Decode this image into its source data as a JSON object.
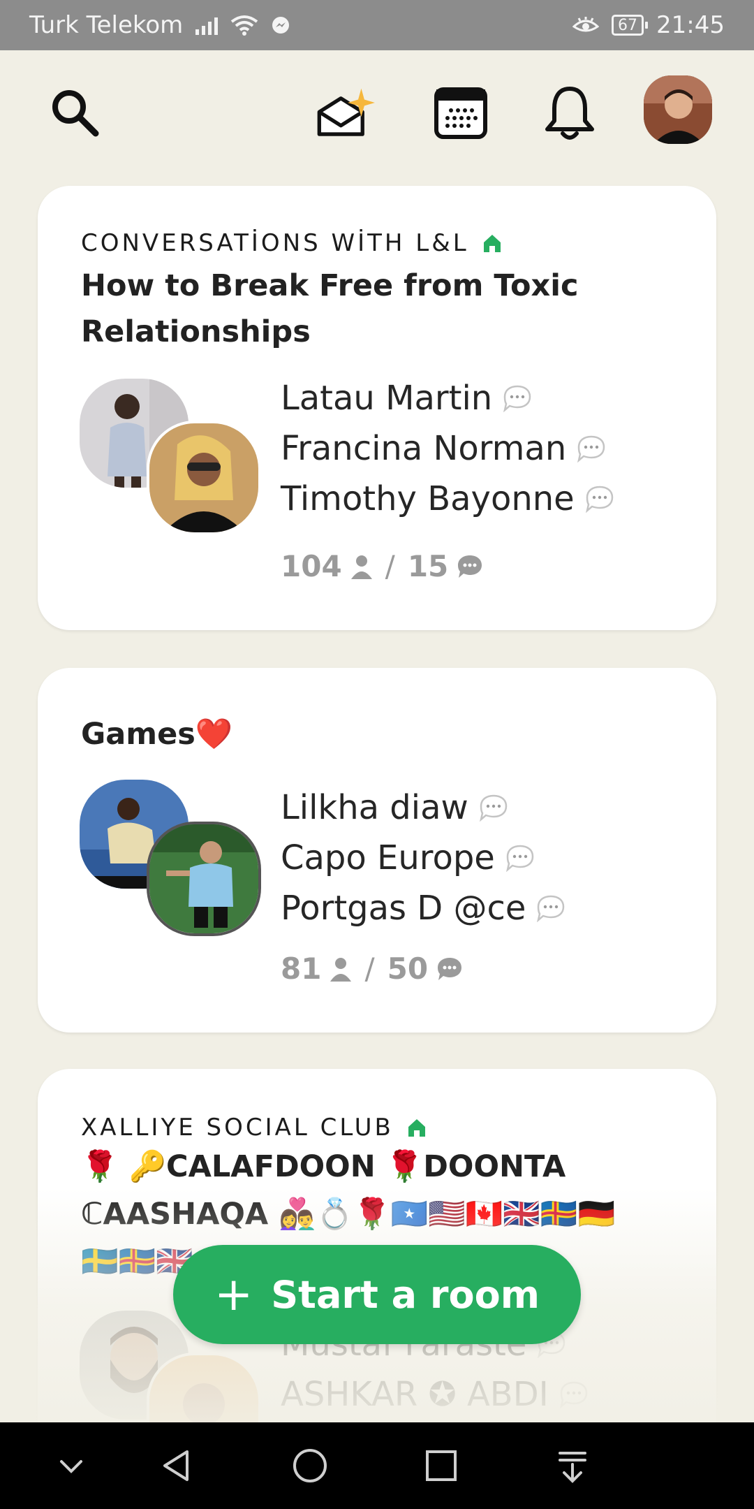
{
  "status_bar": {
    "carrier": "Turk Telekom",
    "battery": "67",
    "time": "21:45"
  },
  "header": {
    "icons": [
      "search-icon",
      "invite-envelope-icon",
      "calendar-icon",
      "bell-icon",
      "profile-avatar"
    ]
  },
  "rooms": [
    {
      "club": "CONVERSATİONS WİTH L&L",
      "title": "How to Break Free from Toxic Relationships",
      "speakers": [
        "Latau Martin",
        "Francina Norman",
        "Timothy Bayonne"
      ],
      "listeners": "104",
      "speaking": "15"
    },
    {
      "club": "",
      "title": "Games❤️",
      "speakers": [
        "Lilkha diaw",
        "Capo Europe",
        "Portgas D @ce"
      ],
      "listeners": "81",
      "speaking": "50"
    },
    {
      "club": "XALLIYE SOCIAL CLUB",
      "title_line1": "🌹 🔑CALAFDOON 🌹DOONTA",
      "title_line2": "ℂAASHAQA 👩‍❤️‍👨💍🌹🇸🇴🇺🇸🇨🇦🇬🇧🇦🇽🇩🇪",
      "title_line3": "🇸🇪🇦🇽🇬🇧",
      "speakers": [
        "Mustaf Faraste",
        "ASHKAR ✪ ABDI"
      ]
    }
  ],
  "start_room": {
    "plus": "+",
    "label": "Start a room"
  },
  "colors": {
    "background": "#f1efe5",
    "accent_green": "#27ae60",
    "status_bar": "#8c8c8c"
  }
}
